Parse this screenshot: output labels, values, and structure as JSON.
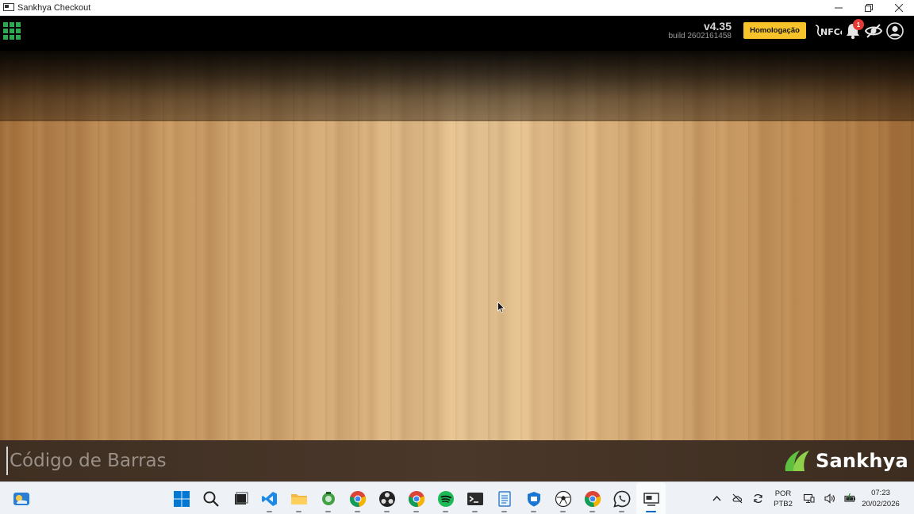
{
  "window": {
    "title": "Sankhya Checkout"
  },
  "header": {
    "version": "v4.35",
    "build": "build 2602161458",
    "environment_badge": "Homologação",
    "nfce_label": "NFCe",
    "notification_count": "1"
  },
  "checkout": {
    "barcode_placeholder": "Código de Barras",
    "brand": "Sankhya"
  },
  "taskbar": {
    "apps": [
      "windows-start-icon",
      "search-icon",
      "task-view-icon",
      "vscode-icon",
      "file-explorer-icon",
      "snip-icon",
      "chrome-icon",
      "obs-icon",
      "chrome-icon",
      "spotify-icon",
      "terminal-icon",
      "notepad-icon",
      "defender-icon",
      "soccer-icon",
      "chrome-icon",
      "whatsapp-icon",
      "checkout-icon"
    ],
    "language_top": "POR",
    "language_bottom": "PTB2",
    "time": "07:23",
    "date": "20/02/2026"
  },
  "colors": {
    "accent_green": "#2fa84f",
    "badge_yellow": "#f6c32a",
    "badge_red": "#e53935"
  }
}
